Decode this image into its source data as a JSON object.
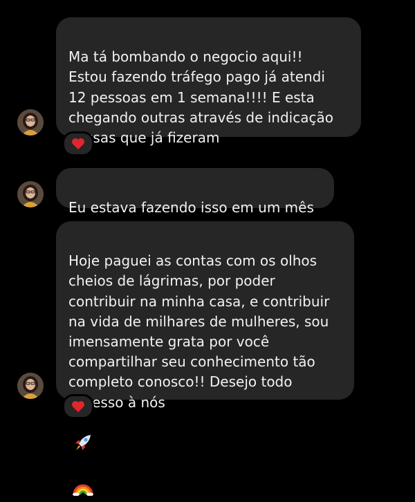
{
  "colors": {
    "background": "#000000",
    "bubble": "#262626",
    "text": "#f2f2f2",
    "heart": "#e0262e"
  },
  "messages": [
    {
      "text": "Ma tá bombando o negocio aqui!!\nEstou fazendo tráfego pago já atendi\n12 pessoas em 1 semana!!!! E esta\nchegando outras através de indicação\ndessas que já fizeram",
      "trailing_emoji": "red-heart-icon",
      "reaction": "red-heart-icon"
    },
    {
      "text": "Eu estava fazendo isso em um mês"
    },
    {
      "text": "Hoje paguei as contas com os olhos\ncheios de lágrimas, por poder\ncontribuir na minha casa, e contribuir\nna vida de milhares de mulheres, sou\nimensamente  grata por você\ncompartilhar seu conhecimento  tão\ncompleto conosco!! Desejo todo\nsucesso à nós",
      "trailing_emoji": [
        "rocket-icon",
        "rainbow-icon"
      ],
      "reaction": "red-heart-icon"
    }
  ]
}
